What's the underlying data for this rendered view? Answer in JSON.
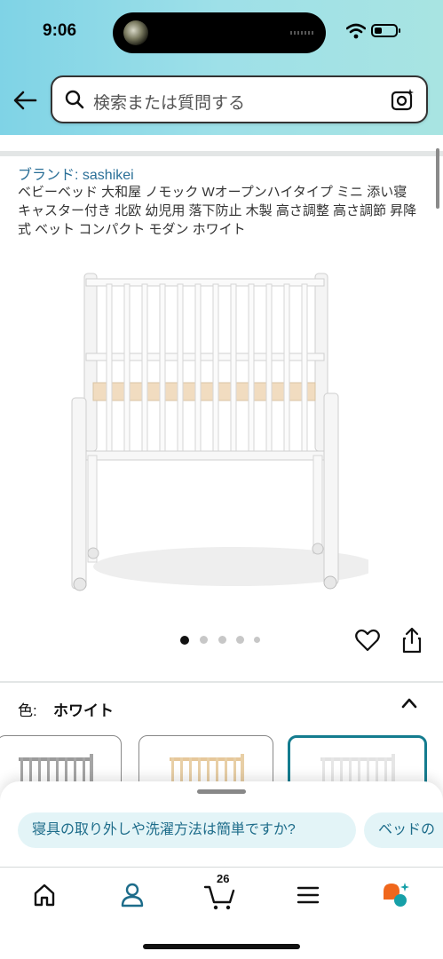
{
  "status_bar": {
    "time": "9:06"
  },
  "search": {
    "placeholder": "検索または質問する"
  },
  "product": {
    "brand": "ブランド: sashikei",
    "title": "ベビーベッド 大和屋 ノモック Wオープンハイタイプ ミニ 添い寝 キャスター付き 北欧 幼児用 落下防止 木製 高さ調整 高さ調節 昇降式 ベット コンパクト モダン ホワイト",
    "image_count": 5,
    "active_image_index": 0
  },
  "color": {
    "label": "色:",
    "value": "ホワイト"
  },
  "swatches": [
    {
      "name": "gray",
      "selected": false
    },
    {
      "name": "natural",
      "selected": false
    },
    {
      "name": "white",
      "selected": true
    }
  ],
  "suggestions": [
    "寝具の取り外しや洗濯方法は簡単ですか?",
    "ベッドの"
  ],
  "nav": {
    "cart_count": "26",
    "items": [
      "home-icon",
      "account-icon",
      "cart-icon",
      "menu-icon",
      "rufus-icon"
    ]
  },
  "colors": {
    "accent": "#147c8f",
    "link": "#2a6f97",
    "chip_bg": "#e3f4f7",
    "header_gradient_start": "#7fd3e6",
    "header_gradient_end": "#a8e4e2"
  }
}
